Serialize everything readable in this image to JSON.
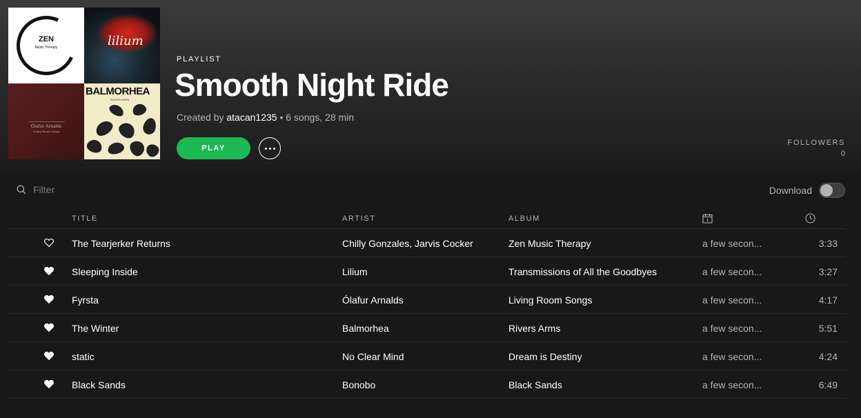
{
  "header": {
    "type_label": "PLAYLIST",
    "title": "Smooth Night Ride",
    "created_by_prefix": "Created by",
    "owner": "atacan1235",
    "summary": "• 6 songs, 28 min",
    "play_label": "PLAY",
    "followers_label": "FOLLOWERS",
    "followers_count": "0"
  },
  "covers": {
    "zen_title": "ZEN",
    "zen_subtitle": "Music Therapy",
    "lilium_title": "lilium",
    "olafur_title": "Ólafur Arnalds",
    "olafur_subtitle": "Living Room Songs",
    "balmorhea_title": "BALMORHEA",
    "balmorhea_subtitle": "RIVERS ARMS"
  },
  "controls": {
    "filter_placeholder": "Filter",
    "download_label": "Download",
    "download_enabled": false
  },
  "table": {
    "columns": {
      "title": "TITLE",
      "artist": "ARTIST",
      "album": "ALBUM",
      "date_icon": "calendar-icon",
      "duration_icon": "clock-icon"
    },
    "rows": [
      {
        "liked": false,
        "title": "The Tearjerker Returns",
        "artist": "Chilly Gonzales, Jarvis Cocker",
        "album": "Zen Music Therapy",
        "added": "a few secon...",
        "duration": "3:33"
      },
      {
        "liked": true,
        "title": "Sleeping Inside",
        "artist": "Lilium",
        "album": "Transmissions of All the Goodbyes",
        "added": "a few secon...",
        "duration": "3:27"
      },
      {
        "liked": true,
        "title": "Fyrsta",
        "artist": "Ólafur Arnalds",
        "album": "Living Room Songs",
        "added": "a few secon...",
        "duration": "4:17"
      },
      {
        "liked": true,
        "title": "The Winter",
        "artist": "Balmorhea",
        "album": "Rivers Arms",
        "added": "a few secon...",
        "duration": "5:51"
      },
      {
        "liked": true,
        "title": "static",
        "artist": "No Clear Mind",
        "album": "Dream is Destiny",
        "added": "a few secon...",
        "duration": "4:24"
      },
      {
        "liked": true,
        "title": "Black Sands",
        "artist": "Bonobo",
        "album": "Black Sands",
        "added": "a few secon...",
        "duration": "6:49"
      }
    ]
  },
  "colors": {
    "accent": "#1db954",
    "background": "#181818",
    "muted_text": "#b3b3b3"
  }
}
